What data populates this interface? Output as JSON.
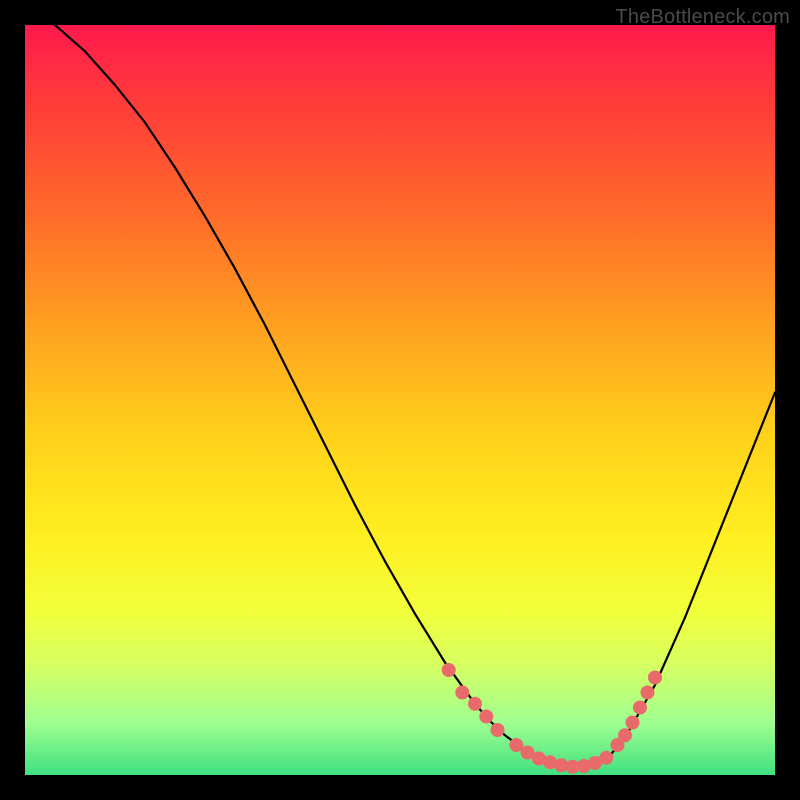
{
  "watermark": "TheBottleneck.com",
  "chart_data": {
    "type": "line",
    "title": "",
    "xlabel": "",
    "ylabel": "",
    "xlim": [
      0,
      100
    ],
    "ylim": [
      0,
      100
    ],
    "series": [
      {
        "name": "curve",
        "x": [
          0,
          4,
          8,
          12,
          16,
          20,
          24,
          28,
          32,
          36,
          40,
          44,
          48,
          52,
          56,
          60,
          62,
          64,
          66,
          68,
          70,
          72,
          74,
          76,
          78,
          80,
          84,
          88,
          92,
          96,
          100
        ],
        "y": [
          103,
          100,
          96.5,
          92,
          87,
          81,
          74.5,
          67.5,
          60,
          52,
          44,
          36,
          28.5,
          21.5,
          15,
          9.5,
          7.2,
          5.3,
          3.8,
          2.6,
          1.8,
          1.3,
          1.1,
          1.4,
          2.6,
          5,
          12,
          21,
          31,
          41,
          51
        ]
      }
    ],
    "markers": {
      "name": "dots",
      "color": "#e86a6a",
      "points": [
        {
          "x": 56.5,
          "y": 14.0
        },
        {
          "x": 58.3,
          "y": 11.0
        },
        {
          "x": 60.0,
          "y": 9.5
        },
        {
          "x": 61.5,
          "y": 7.8
        },
        {
          "x": 63.0,
          "y": 6.0
        },
        {
          "x": 65.5,
          "y": 4.0
        },
        {
          "x": 67.0,
          "y": 3.0
        },
        {
          "x": 68.5,
          "y": 2.2
        },
        {
          "x": 70.0,
          "y": 1.7
        },
        {
          "x": 71.5,
          "y": 1.3
        },
        {
          "x": 73.0,
          "y": 1.1
        },
        {
          "x": 74.5,
          "y": 1.2
        },
        {
          "x": 76.0,
          "y": 1.6
        },
        {
          "x": 77.5,
          "y": 2.3
        },
        {
          "x": 79.0,
          "y": 4.0
        },
        {
          "x": 80.0,
          "y": 5.3
        },
        {
          "x": 81.0,
          "y": 7.0
        },
        {
          "x": 82.0,
          "y": 9.0
        },
        {
          "x": 83.0,
          "y": 11.0
        },
        {
          "x": 84.0,
          "y": 13.0
        }
      ]
    }
  }
}
